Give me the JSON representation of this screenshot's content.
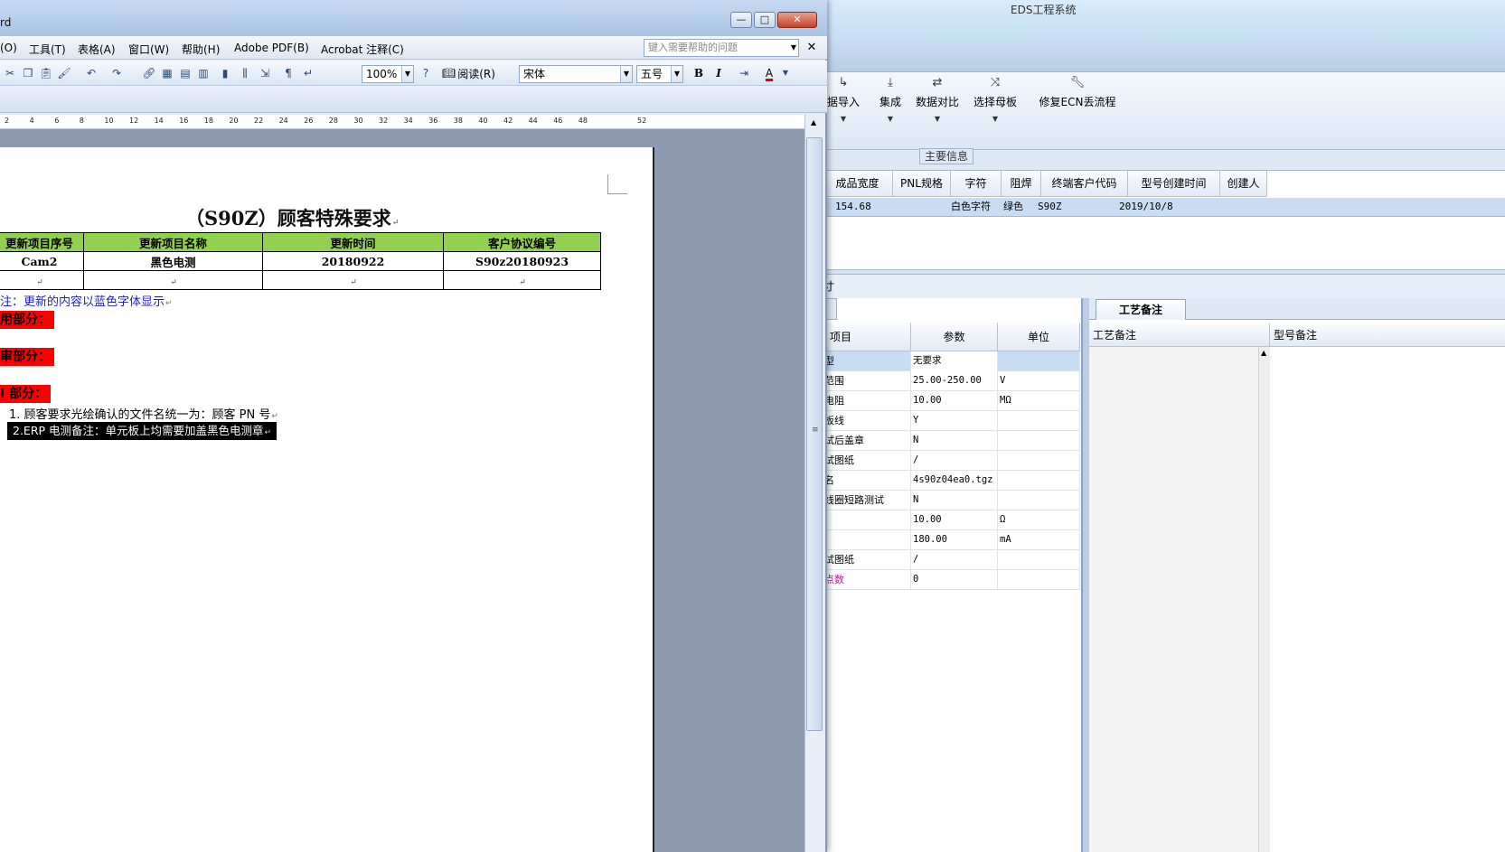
{
  "eds": {
    "title": "EDS工程系统",
    "ribbon": [
      {
        "label": "据导入",
        "icon": "arrow-icon"
      },
      {
        "label": "集成",
        "icon": "download-icon"
      },
      {
        "label": "数据对比",
        "icon": "compare-icon"
      },
      {
        "label": "选择母板",
        "icon": "shuffle-icon"
      },
      {
        "label": "修复ECN丢流程",
        "icon": "wrench-icon"
      }
    ],
    "section_title": "主要信息",
    "grid_headers": [
      "成品宽度",
      "PNL规格",
      "字符",
      "阻焊",
      "终端客户代码",
      "型号创建时间",
      "创建人"
    ],
    "grid_row": [
      "154.68",
      "",
      "白色字符",
      "绿色",
      "S90Z",
      "2019/10/8",
      ""
    ],
    "lower_label": "寸",
    "param_headers": [
      "项目",
      "参数",
      "单位"
    ],
    "params": [
      {
        "item": "型",
        "value": "无要求",
        "unit": ""
      },
      {
        "item": "范围",
        "value": "25.00-250.00",
        "unit": "V"
      },
      {
        "item": "电阻",
        "value": "10.00",
        "unit": "MΩ"
      },
      {
        "item": "板线",
        "value": "Y",
        "unit": ""
      },
      {
        "item": "试后盖章",
        "value": "N",
        "unit": ""
      },
      {
        "item": "试图纸",
        "value": "/",
        "unit": ""
      },
      {
        "item": "名",
        "value": "4s90z04ea0.tgz",
        "unit": ""
      },
      {
        "item": "线圈短路测试",
        "value": "N",
        "unit": ""
      },
      {
        "item": "",
        "value": "10.00",
        "unit": "Ω"
      },
      {
        "item": "",
        "value": "180.00",
        "unit": "mA"
      },
      {
        "item": "试图纸",
        "value": "/",
        "unit": ""
      },
      {
        "item": "点数",
        "value": "0",
        "unit": ""
      }
    ],
    "remark_tab": "工艺备注",
    "remark_headers": [
      "工艺备注",
      "型号备注"
    ]
  },
  "word": {
    "title": "rd",
    "controls": {
      "minimize": "—",
      "maximize": "□",
      "close": "✕"
    },
    "menu": [
      "(O)",
      "工具(T)",
      "表格(A)",
      "窗口(W)",
      "帮助(H)",
      "Adobe PDF(B)",
      "Acrobat 注释(C)"
    ],
    "help_placeholder": "键入需要帮助的问题",
    "zoom": "100%",
    "read_button": "阅读(R)",
    "font_name": "宋体",
    "font_size": "五号",
    "ruler_ticks": [
      "2",
      "4",
      "6",
      "8",
      "10",
      "12",
      "14",
      "16",
      "18",
      "20",
      "22",
      "24",
      "26",
      "28",
      "30",
      "32",
      "34",
      "36",
      "38",
      "40",
      "42",
      "44",
      "46",
      "48",
      "52"
    ],
    "doc": {
      "title": "（S90Z）顾客特殊要求",
      "table_headers": [
        "更新项目序号",
        "更新项目名称",
        "更新时间",
        "客户协议编号"
      ],
      "table_rows": [
        [
          "Cam2",
          "黑色电测",
          "20180922",
          "S90z20180923"
        ],
        [
          "",
          "",
          "",
          ""
        ]
      ],
      "note": "注：更新的内容以蓝色字体显示",
      "section1": "用部分：",
      "section2": "审部分：",
      "section3": "I 部分：",
      "item1": "1. 顾客要求光绘确认的文件名统一为：顾客 PN 号",
      "item2": "2.ERP 电测备注：单元板上均需要加盖黑色电测章"
    }
  }
}
